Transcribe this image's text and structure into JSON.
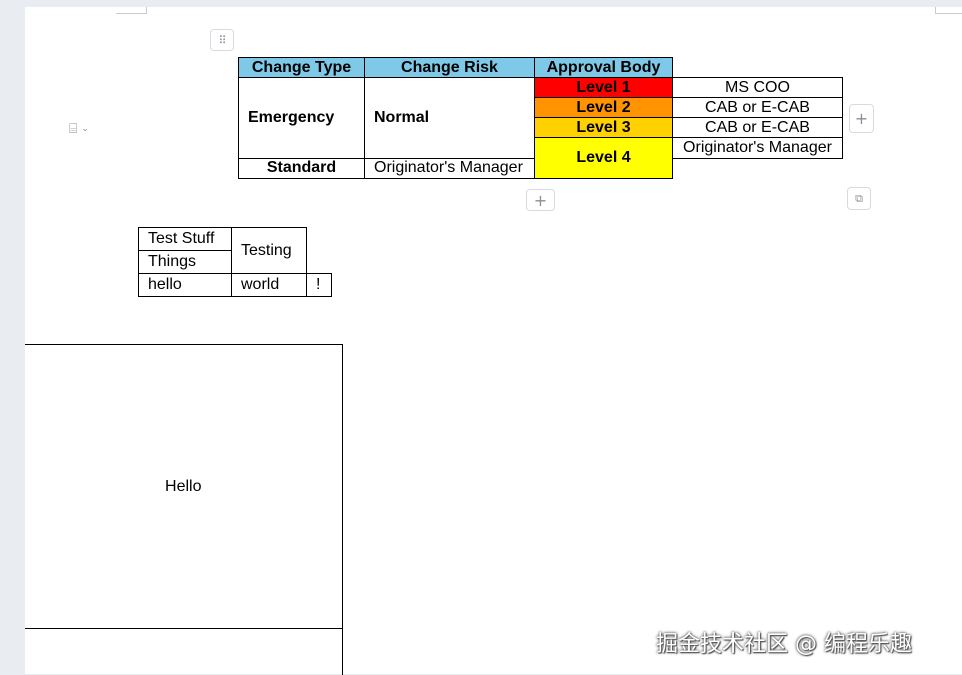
{
  "toolbar_icons": {
    "drag": "drag-handle-icon",
    "align": "align-icon",
    "add_column": "plus-icon",
    "add_row": "plus-icon",
    "resize": "resize-icon"
  },
  "colors": {
    "header_bg": "#7ec8e8",
    "level1": "#ff0000",
    "level2": "#ff9400",
    "level3": "#ffd100",
    "level4": "#ffff00"
  },
  "change_table": {
    "headers": [
      "Change Type",
      "Change Risk",
      "Approval Body"
    ],
    "emergency": "Emergency",
    "normal": "Normal",
    "standard": "Standard",
    "originator_manager": "Originator's Manager",
    "levels": [
      "Level 1",
      "Level 2",
      "Level 3",
      "Level 4"
    ],
    "approvers": [
      "MS COO",
      "CAB or E-CAB",
      "CAB or E-CAB",
      "Originator's Manager"
    ]
  },
  "test_table": {
    "test_stuff": "Test Stuff",
    "things": "Things",
    "testing": "Testing",
    "hello": "hello",
    "world": "world",
    "bang": "!"
  },
  "hello_table": {
    "hello": "Hello"
  },
  "watermark": "掘金技术社区 @ 编程乐趣"
}
